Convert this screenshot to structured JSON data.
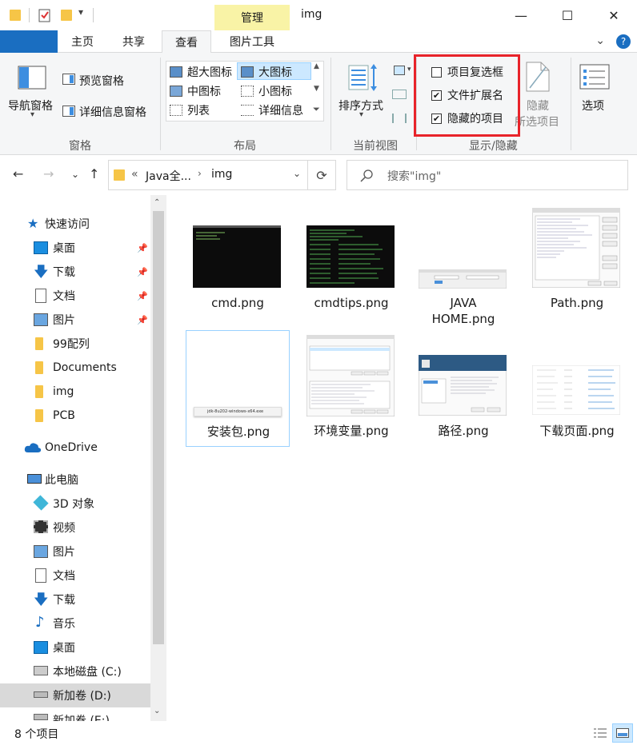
{
  "window": {
    "title": "img",
    "context_tab": "管理",
    "controls": {
      "minimize": "—",
      "maximize": "☐",
      "close": "✕"
    }
  },
  "ribbon_tabs": [
    "文件",
    "主页",
    "共享",
    "查看",
    "图片工具"
  ],
  "ribbon": {
    "panes": {
      "nav_pane": "导航窗格",
      "preview_pane": "预览窗格",
      "details_pane": "详细信息窗格",
      "label": "窗格"
    },
    "layout": {
      "items": [
        "超大图标",
        "大图标",
        "中图标",
        "小图标",
        "列表",
        "详细信息"
      ],
      "label": "布局"
    },
    "current_view": {
      "sort": "排序方式",
      "label": "当前视图"
    },
    "show_hide": {
      "checkboxes": [
        {
          "label": "项目复选框",
          "checked": false
        },
        {
          "label": "文件扩展名",
          "checked": true
        },
        {
          "label": "隐藏的项目",
          "checked": true
        }
      ],
      "hide_selected_line1": "隐藏",
      "hide_selected_line2": "所选项目",
      "label": "显示/隐藏"
    },
    "options": "选项"
  },
  "address": {
    "prefix": "«",
    "crumb1": "Java全...",
    "crumb2": "img",
    "search_placeholder": "搜索\"img\""
  },
  "nav": {
    "quick_access": "快速访问",
    "items": [
      {
        "label": "桌面",
        "pinned": true
      },
      {
        "label": "下载",
        "pinned": true
      },
      {
        "label": "文档",
        "pinned": true
      },
      {
        "label": "图片",
        "pinned": true
      },
      {
        "label": "99配列",
        "pinned": false
      },
      {
        "label": "Documents",
        "pinned": false
      },
      {
        "label": "img",
        "pinned": false
      },
      {
        "label": "PCB",
        "pinned": false
      }
    ],
    "onedrive": "OneDrive",
    "this_pc": "此电脑",
    "pc_items": [
      "3D 对象",
      "视频",
      "图片",
      "文档",
      "下载",
      "音乐",
      "桌面",
      "本地磁盘 (C:)",
      "新加卷 (D:)",
      "新加卷 (E:)"
    ]
  },
  "files": [
    {
      "name": "cmd.png"
    },
    {
      "name": "cmdtips.png"
    },
    {
      "name1": "JAVA",
      "name2": "HOME.png"
    },
    {
      "name": "Path.png"
    },
    {
      "name": "安装包.png",
      "thumb_text": "jdk-8u202-windows-x64.exe"
    },
    {
      "name": "环境变量.png"
    },
    {
      "name": "路径.png"
    },
    {
      "name": "下载页面.png"
    }
  ],
  "status": {
    "count": "8 个项目"
  },
  "colors": {
    "accent": "#1a6ec1",
    "context_tab": "#f9f3a6",
    "highlight": "#e8232a",
    "selection": "#cce8ff"
  }
}
